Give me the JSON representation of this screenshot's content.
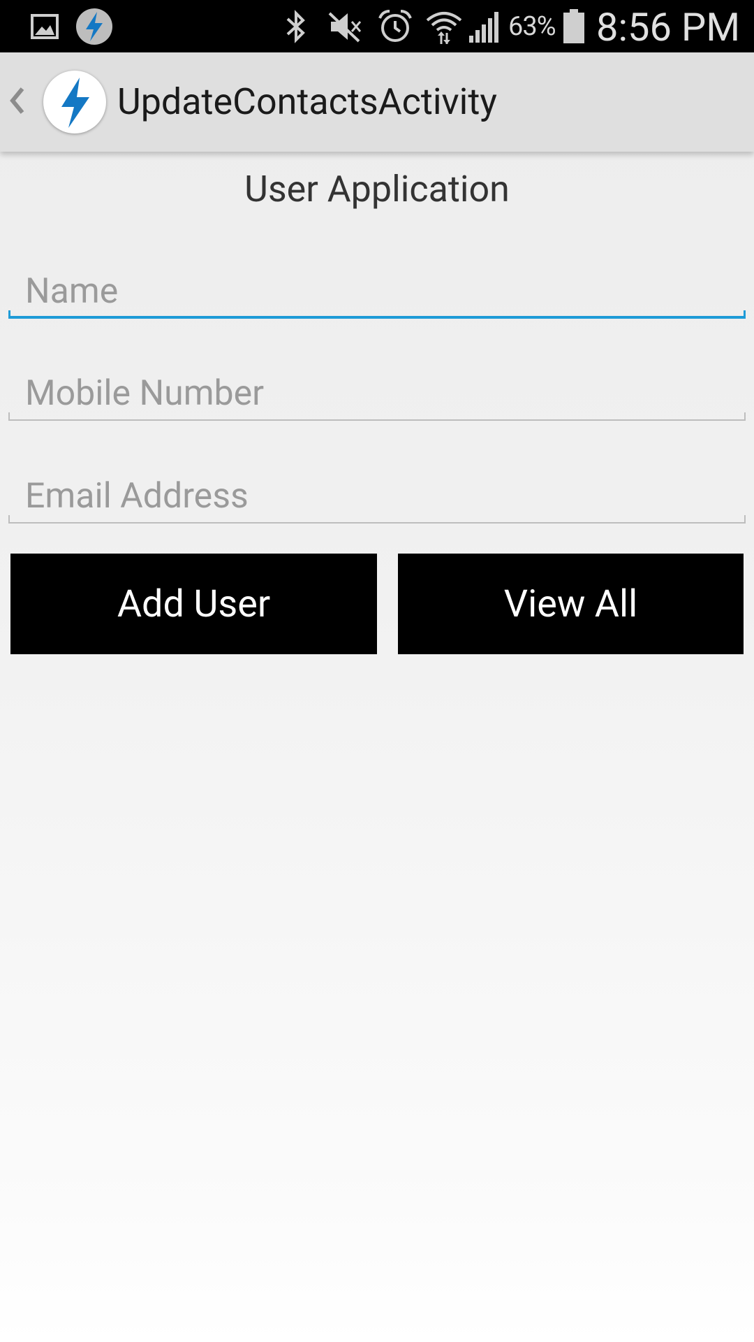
{
  "status_bar": {
    "battery_percent": "63%",
    "time": "8:56 PM",
    "icons": [
      "image-notification-icon",
      "app-notification-icon",
      "bluetooth-icon",
      "mute-icon",
      "alarm-icon",
      "wifi-icon",
      "signal-icon",
      "battery-icon"
    ]
  },
  "action_bar": {
    "title": "UpdateContactsActivity",
    "back_icon": "chevron-left-icon",
    "logo_icon": "lightning-bolt-icon"
  },
  "form": {
    "heading": "User Application",
    "name_placeholder": "Name",
    "mobile_placeholder": "Mobile Number",
    "email_placeholder": "Email Address",
    "name_value": "",
    "mobile_value": "",
    "email_value": ""
  },
  "buttons": {
    "add_user": "Add User",
    "view_all": "View All"
  },
  "colors": {
    "accent": "#1e9bd7",
    "logo_blue": "#1478c4",
    "button_bg": "#000000",
    "button_text": "#ffffff"
  }
}
